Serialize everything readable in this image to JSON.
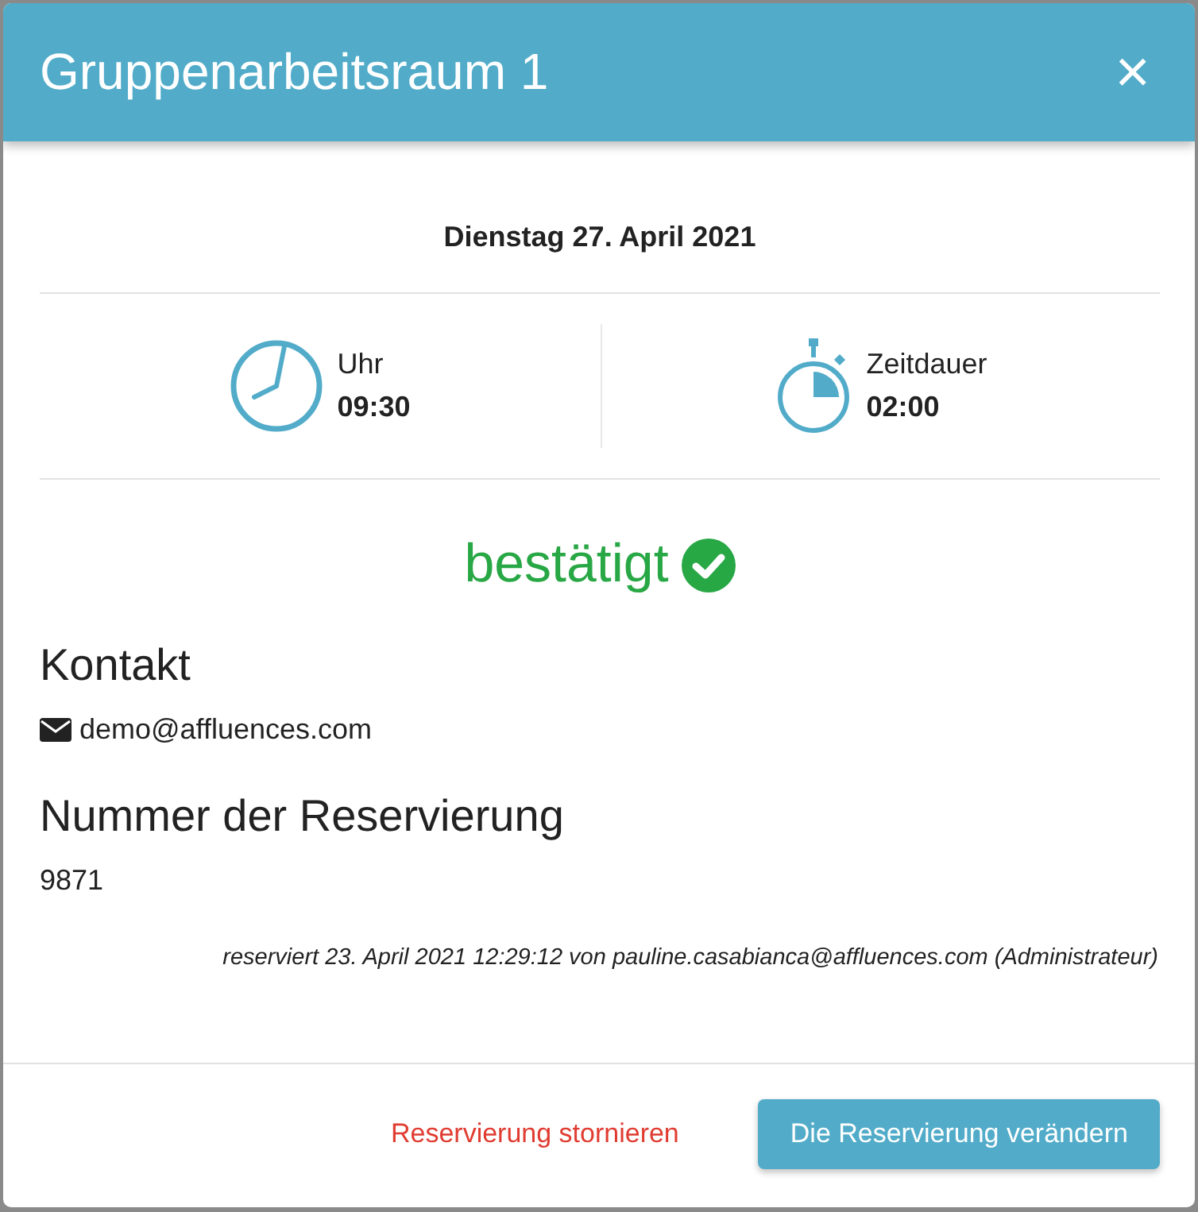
{
  "dialog": {
    "title": "Gruppenarbeitsraum 1",
    "close": "×"
  },
  "date": "Dienstag 27. April 2021",
  "info": [
    {
      "kind": "clock",
      "label": "Uhr",
      "value": "09:30"
    },
    {
      "kind": "stopwatch",
      "label": "Zeitdauer",
      "value": "02:00"
    }
  ],
  "status": {
    "kind": "confirmed",
    "label": "bestätigt"
  },
  "contact": {
    "heading": "Kontakt",
    "email": "demo@affluences.com"
  },
  "reservation": {
    "heading": "Nummer der Reservierung",
    "number": "9871",
    "note": "reserviert 23. April 2021 12:29:12 von pauline.casabianca@affluences.com (Administrateur)"
  },
  "buttons": [
    {
      "kind": "danger",
      "label": "Reservierung stornieren"
    },
    {
      "kind": "primary",
      "label": "Die Reservierung verändern"
    }
  ]
}
